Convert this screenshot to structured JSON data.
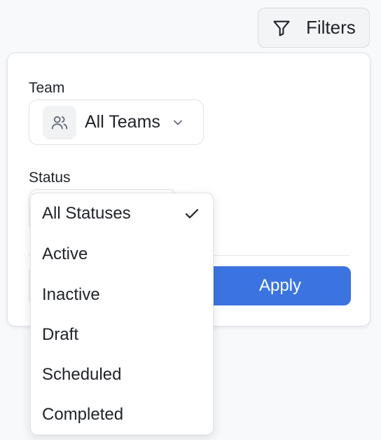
{
  "toolbar": {
    "filters_label": "Filters",
    "filters_icon": "funnel-icon"
  },
  "panel": {
    "team": {
      "label": "Team",
      "value": "All Teams",
      "icon": "users-icon"
    },
    "status": {
      "label": "Status",
      "selected": "All Statuses",
      "options": [
        "All Statuses",
        "Active",
        "Inactive",
        "Draft",
        "Scheduled",
        "Completed"
      ]
    },
    "apply_label": "Apply"
  },
  "colors": {
    "accent": "#3b74e0",
    "background": "#f8f9fb",
    "border": "#dfe2e7"
  }
}
